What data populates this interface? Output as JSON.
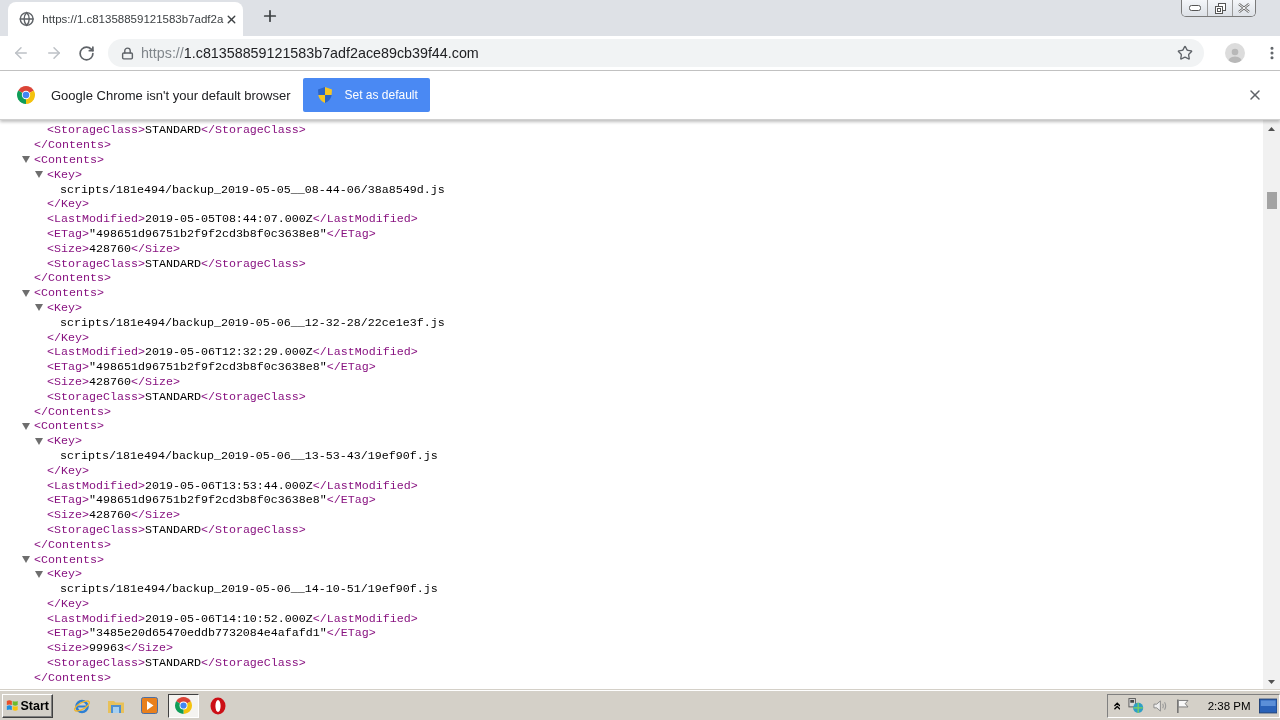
{
  "tabs": [
    {
      "title": "https://1.c81358859121583b7adf2a",
      "selected": true
    }
  ],
  "nav_buttons": [
    {
      "kind": "back",
      "disabled": true
    },
    {
      "kind": "forward",
      "disabled": true
    },
    {
      "kind": "reload",
      "disabled": false
    }
  ],
  "address_bar": {
    "scheme": "https://",
    "host": "1.c81358859121583b7adf2ace89cb39f44.com"
  },
  "infobar": {
    "message": "Google Chrome isn't your default browser",
    "button": "Set as default"
  },
  "xml": [
    {
      "kind": "tail",
      "children": [
        {
          "kind": "leaf",
          "open": "<StorageClass>",
          "text": "STANDARD",
          "close": "</StorageClass>"
        }
      ],
      "close": "</Contents>"
    },
    {
      "kind": "element",
      "expanded": true,
      "open": "<Contents>",
      "close": "</Contents>",
      "children": [
        {
          "kind": "element",
          "expanded": true,
          "open": "<Key>",
          "close": "</Key>",
          "children": [
            {
              "kind": "text",
              "text": "scripts/181e494/backup_2019-05-05__08-44-06/38a8549d.js"
            }
          ]
        },
        {
          "kind": "leaf",
          "open": "<LastModified>",
          "text": "2019-05-05T08:44:07.000Z",
          "close": "</LastModified>"
        },
        {
          "kind": "leaf",
          "open": "<ETag>",
          "text": "\"498651d96751b2f9f2cd3b8f0c3638e8\"",
          "close": "</ETag>"
        },
        {
          "kind": "leaf",
          "open": "<Size>",
          "text": "428760",
          "close": "</Size>"
        },
        {
          "kind": "leaf",
          "open": "<StorageClass>",
          "text": "STANDARD",
          "close": "</StorageClass>"
        }
      ]
    },
    {
      "kind": "element",
      "expanded": true,
      "open": "<Contents>",
      "close": "</Contents>",
      "children": [
        {
          "kind": "element",
          "expanded": true,
          "open": "<Key>",
          "close": "</Key>",
          "children": [
            {
              "kind": "text",
              "text": "scripts/181e494/backup_2019-05-06__12-32-28/22ce1e3f.js"
            }
          ]
        },
        {
          "kind": "leaf",
          "open": "<LastModified>",
          "text": "2019-05-06T12:32:29.000Z",
          "close": "</LastModified>"
        },
        {
          "kind": "leaf",
          "open": "<ETag>",
          "text": "\"498651d96751b2f9f2cd3b8f0c3638e8\"",
          "close": "</ETag>"
        },
        {
          "kind": "leaf",
          "open": "<Size>",
          "text": "428760",
          "close": "</Size>"
        },
        {
          "kind": "leaf",
          "open": "<StorageClass>",
          "text": "STANDARD",
          "close": "</StorageClass>"
        }
      ]
    },
    {
      "kind": "element",
      "expanded": true,
      "open": "<Contents>",
      "close": "</Contents>",
      "children": [
        {
          "kind": "element",
          "expanded": true,
          "open": "<Key>",
          "close": "</Key>",
          "children": [
            {
              "kind": "text",
              "text": "scripts/181e494/backup_2019-05-06__13-53-43/19ef90f.js"
            }
          ]
        },
        {
          "kind": "leaf",
          "open": "<LastModified>",
          "text": "2019-05-06T13:53:44.000Z",
          "close": "</LastModified>"
        },
        {
          "kind": "leaf",
          "open": "<ETag>",
          "text": "\"498651d96751b2f9f2cd3b8f0c3638e8\"",
          "close": "</ETag>"
        },
        {
          "kind": "leaf",
          "open": "<Size>",
          "text": "428760",
          "close": "</Size>"
        },
        {
          "kind": "leaf",
          "open": "<StorageClass>",
          "text": "STANDARD",
          "close": "</StorageClass>"
        }
      ]
    },
    {
      "kind": "element",
      "expanded": true,
      "open": "<Contents>",
      "close": "</Contents>",
      "children": [
        {
          "kind": "element",
          "expanded": true,
          "open": "<Key>",
          "close": "</Key>",
          "children": [
            {
              "kind": "text",
              "text": "scripts/181e494/backup_2019-05-06__14-10-51/19ef90f.js"
            }
          ]
        },
        {
          "kind": "leaf",
          "open": "<LastModified>",
          "text": "2019-05-06T14:10:52.000Z",
          "close": "</LastModified>"
        },
        {
          "kind": "leaf",
          "open": "<ETag>",
          "text": "\"3485e20d65470eddb7732084e4afafd1\"",
          "close": "</ETag>"
        },
        {
          "kind": "leaf",
          "open": "<Size>",
          "text": "99963",
          "close": "</Size>"
        },
        {
          "kind": "leaf",
          "open": "<StorageClass>",
          "text": "STANDARD",
          "close": "</StorageClass>"
        }
      ]
    }
  ],
  "taskbar": {
    "start": "Start",
    "apps": [
      {
        "kind": "ring",
        "selected": false
      },
      {
        "kind": "folder",
        "selected": false
      },
      {
        "kind": "player",
        "selected": false
      },
      {
        "kind": "wheel",
        "selected": true
      },
      {
        "kind": "oval",
        "selected": false
      }
    ],
    "clock": "2:38 PM"
  }
}
